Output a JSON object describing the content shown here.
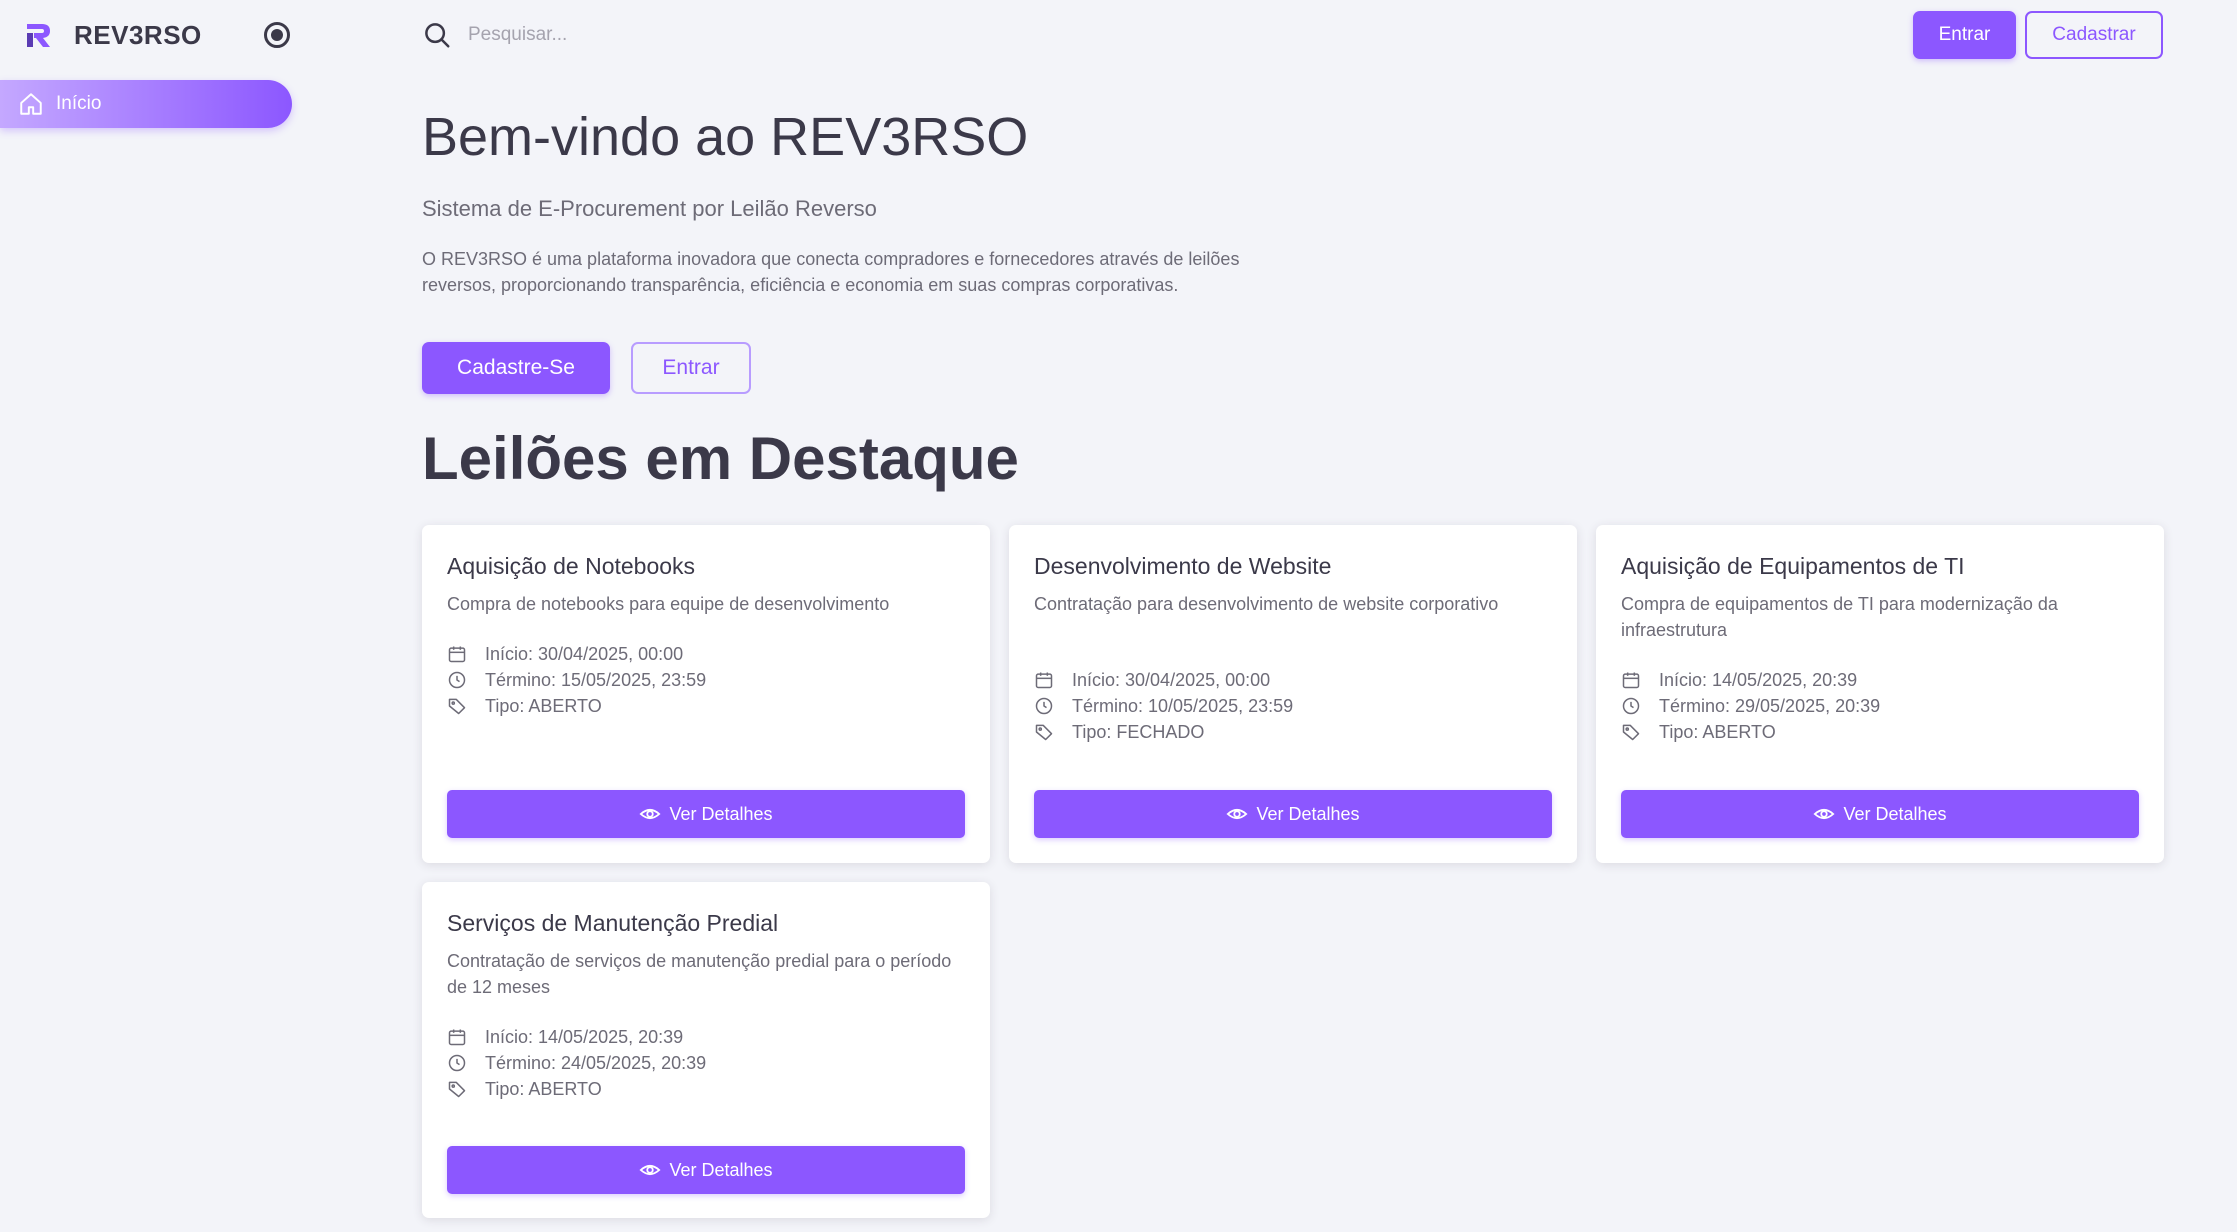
{
  "sidebar": {
    "brand_name": "REV3RSO",
    "items": [
      {
        "label": "Início",
        "icon": "home-icon"
      }
    ]
  },
  "topbar": {
    "search_placeholder": "Pesquisar...",
    "enter_label": "Entrar",
    "signup_label": "Cadastrar"
  },
  "hero": {
    "title": "Bem-vindo ao REV3RSO",
    "subtitle": "Sistema de E-Procurement por Leilão Reverso",
    "description": "O REV3RSO é uma plataforma inovadora que conecta compradores e fornecedores através de leilões reversos, proporcionando transparência, eficiência e economia em suas compras corporativas.",
    "signup_label": "Cadastre-Se",
    "enter_label": "Entrar"
  },
  "featured": {
    "title": "Leilões em Destaque",
    "details_label": "Ver Detalhes",
    "cards": [
      {
        "title": "Aquisição de Notebooks",
        "description": "Compra de notebooks para equipe de desenvolvimento",
        "start": "Início: 30/04/2025, 00:00",
        "end": "Término: 15/05/2025, 23:59",
        "type": "Tipo: ABERTO"
      },
      {
        "title": "Desenvolvimento de Website",
        "description": "Contratação para desenvolvimento de website corporativo",
        "start": "Início: 30/04/2025, 00:00",
        "end": "Término: 10/05/2025, 23:59",
        "type": "Tipo: FECHADO"
      },
      {
        "title": "Aquisição de Equipamentos de TI",
        "description": "Compra de equipamentos de TI para modernização da infraestrutura",
        "start": "Início: 14/05/2025, 20:39",
        "end": "Término: 29/05/2025, 20:39",
        "type": "Tipo: ABERTO"
      },
      {
        "title": "Serviços de Manutenção Predial",
        "description": "Contratação de serviços de manutenção predial para o período de 12 meses",
        "start": "Início: 14/05/2025, 20:39",
        "end": "Término: 24/05/2025, 20:39",
        "type": "Tipo: ABERTO"
      }
    ]
  },
  "colors": {
    "primary": "#8c57ff",
    "background": "#f3f4f9",
    "text": "#3b3949",
    "muted": "#6d6b77"
  }
}
